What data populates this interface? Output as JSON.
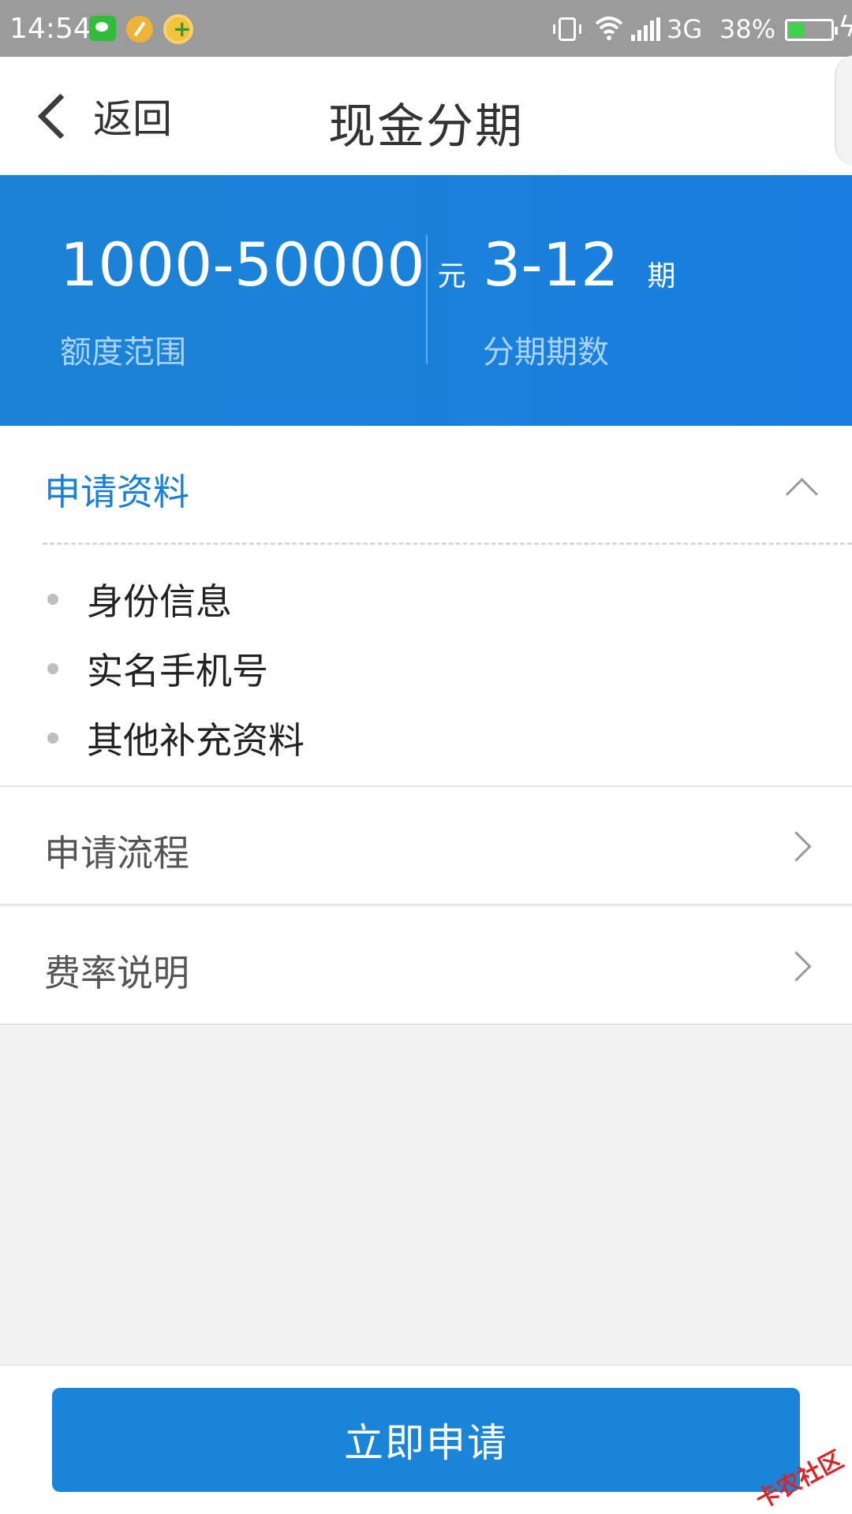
{
  "status_bar": {
    "time": "14:54",
    "network": "3G",
    "battery_percent": "38%",
    "battery_level": 0.38,
    "icons": [
      "wechat-icon",
      "paint-icon",
      "plus-app-icon",
      "vibrate-icon",
      "wifi-icon",
      "signal-icon",
      "battery-icon",
      "charging-icon"
    ]
  },
  "navbar": {
    "back_label": "返回",
    "title": "现金分期"
  },
  "banner": {
    "amount_value": "1000-50000",
    "amount_unit": "元",
    "amount_label": "额度范围",
    "periods_value": "3-12",
    "periods_unit": "期",
    "periods_label": "分期期数"
  },
  "materials": {
    "title": "申请资料",
    "items": [
      "身份信息",
      "实名手机号",
      "其他补充资料"
    ]
  },
  "rows": {
    "process": "申请流程",
    "rate": "费率说明"
  },
  "footer": {
    "apply_label": "立即申请",
    "watermark": "卡农社区"
  },
  "colors": {
    "primary": "#1a84d8",
    "banner_label": "#a9d3fb",
    "status_bar": "#9b9b9b"
  }
}
